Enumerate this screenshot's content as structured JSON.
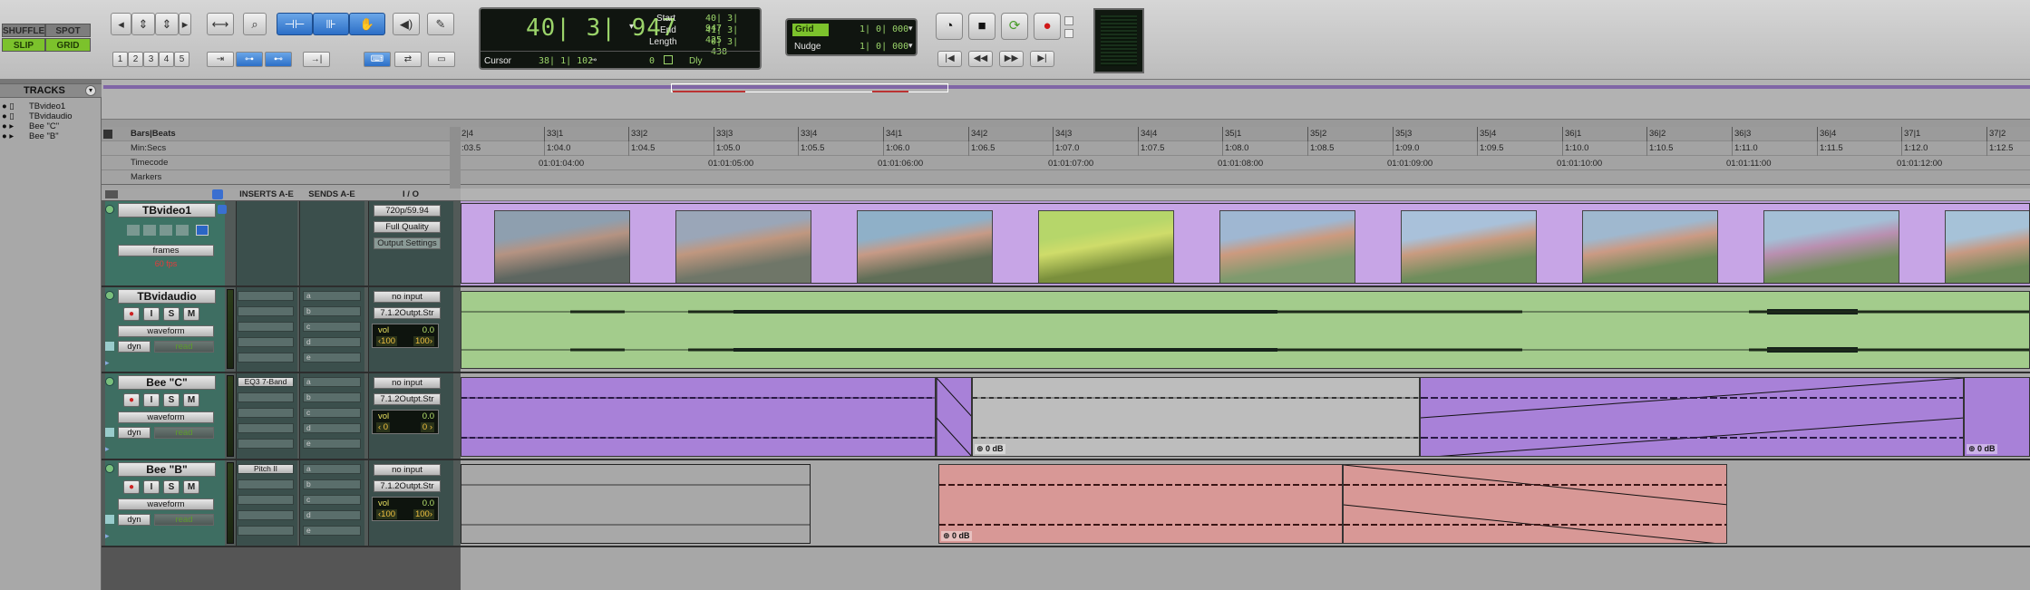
{
  "edit_modes": {
    "shuffle": "SHUFFLE",
    "spot": "SPOT",
    "slip": "SLIP",
    "grid": "GRID"
  },
  "zoom_presets": [
    "1",
    "2",
    "3",
    "4",
    "5"
  ],
  "counter": {
    "main": "40| 3| 947",
    "start_label": "Start",
    "start": "40| 3| 947",
    "end_label": "End",
    "end": "41| 3| 425",
    "length_label": "Length",
    "length": "0| 3| 438",
    "cursor_label": "Cursor",
    "cursor": "38| 1| 102",
    "cursor_val": "0",
    "dly_label": "Dly"
  },
  "grid": {
    "grid_label": "Grid",
    "grid_value": "1| 0| 000",
    "nudge_label": "Nudge",
    "nudge_value": "1| 0| 000"
  },
  "tracks_panel": {
    "title": "TRACKS",
    "items": [
      "TBvideo1",
      "TBvidaudio",
      "Bee \"C\"",
      "Bee \"B\""
    ]
  },
  "rulers": {
    "bars_beats_label": "Bars|Beats",
    "min_secs_label": "Min:Secs",
    "timecode_label": "Timecode",
    "markers_label": "Markers",
    "bars": [
      "2|4",
      "33|1",
      "33|2",
      "33|3",
      "33|4",
      "34|1",
      "34|2",
      "34|3",
      "34|4",
      "35|1",
      "35|2",
      "35|3",
      "35|4",
      "36|1",
      "36|2",
      "36|3",
      "36|4",
      "37|1",
      "37|2"
    ],
    "minsecs": [
      ":03.5",
      "1:04.0",
      "1:04.5",
      "1:05.0",
      "1:05.5",
      "1:06.0",
      "1:06.5",
      "1:07.0",
      "1:07.5",
      "1:08.0",
      "1:08.5",
      "1:09.0",
      "1:09.5",
      "1:10.0",
      "1:10.5",
      "1:11.0",
      "1:11.5",
      "1:12.0",
      "1:12.5"
    ],
    "timecodes": [
      "01:01:04:00",
      "01:01:05:00",
      "01:01:06:00",
      "01:01:07:00",
      "01:01:08:00",
      "01:01:09:00",
      "01:01:10:00",
      "01:01:11:00",
      "01:01:12:00"
    ]
  },
  "columns": {
    "inserts": "INSERTS A-E",
    "sends": "SENDS A-E",
    "io": "I / O"
  },
  "video_track": {
    "name": "TBvideo1",
    "format": "720p/59.94",
    "quality": "Full Quality",
    "output_settings": "Output Settings",
    "view": "frames",
    "fps": "60 fps"
  },
  "audio_tracks": [
    {
      "name": "TBvidaudio",
      "view": "waveform",
      "auto_mode": "read",
      "dyn": "dyn",
      "insert": "",
      "input": "no input",
      "output": "7.1.2Outpt.Str",
      "vol_label": "vol",
      "vol": "0.0",
      "pan_l": "‹100",
      "pan_r": "100›"
    },
    {
      "name": "Bee \"C\"",
      "view": "waveform",
      "auto_mode": "read",
      "dyn": "dyn",
      "insert": "EQ3 7-Band",
      "input": "no input",
      "output": "7.1.2Outpt.Str",
      "vol_label": "vol",
      "vol": "0.0",
      "pan_l": "‹ 0",
      "pan_r": "0 ›"
    },
    {
      "name": "Bee \"B\"",
      "view": "waveform",
      "auto_mode": "read",
      "dyn": "dyn",
      "insert": "Pitch II",
      "input": "no input",
      "output": "7.1.2Outpt.Str",
      "vol_label": "vol",
      "vol": "0.0",
      "pan_l": "‹100",
      "pan_r": "100›"
    }
  ],
  "send_slots": [
    "a",
    "b",
    "c",
    "d",
    "e"
  ],
  "track_buttons": {
    "rec": "●",
    "input": "I",
    "solo": "S",
    "mute": "M"
  },
  "clip_gain": "0 dB",
  "colors": {
    "video": "#c9a6e4",
    "tbvidaudio": "#9fc987",
    "bee_c": "#a97fd6",
    "bee_b": "#d99796",
    "accent_green": "#7cc22c",
    "lcd_green": "#9bd46a"
  }
}
